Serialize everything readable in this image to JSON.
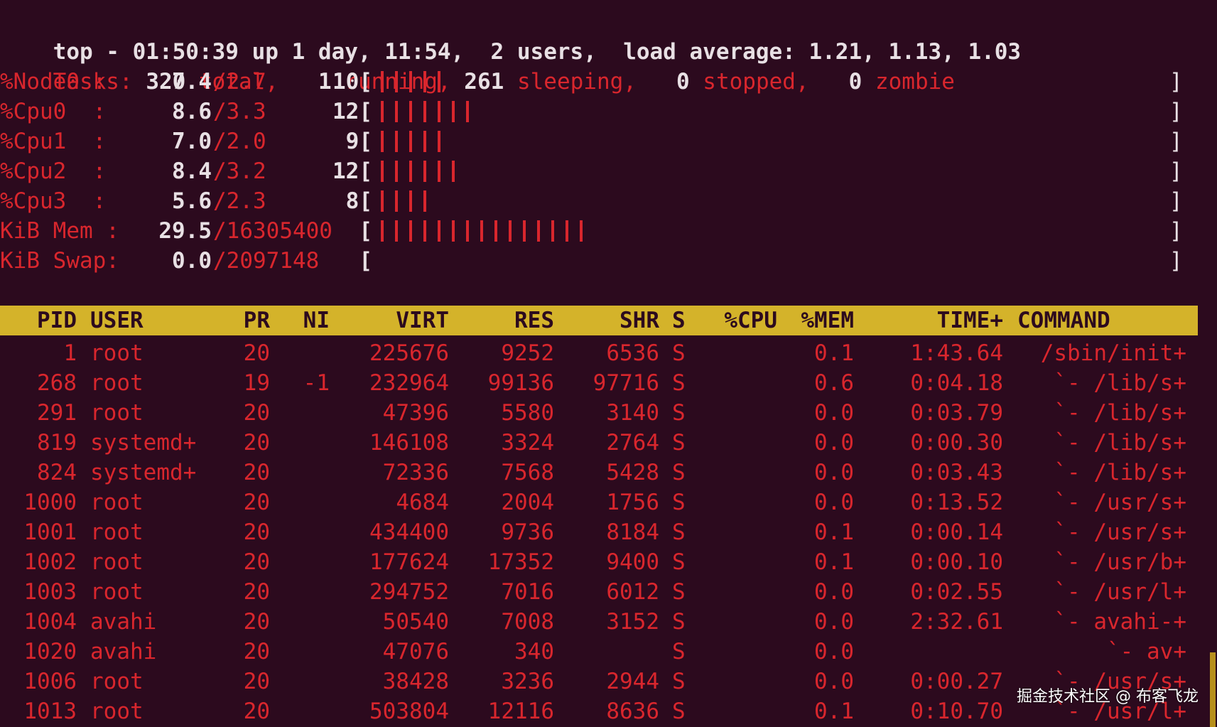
{
  "summary": {
    "line1": "top - 01:50:39 up 1 day, 11:54,  2 users,  load average: 1.21, 1.13, 1.03",
    "tasks": {
      "label": "Tasks:",
      "total": "320",
      "total_label": "total,",
      "running": "1",
      "running_label": "running,",
      "sleeping": "261",
      "sleeping_label": "sleeping,",
      "stopped": "0",
      "stopped_label": "stopped,",
      "zombie": "0",
      "zombie_label": "zombie"
    },
    "meters": [
      {
        "label": "%Node0 :",
        "v1": "7.4",
        "v2": "/2.7",
        "v3": "10[",
        "ticks": 5
      },
      {
        "label": "%Cpu0  :",
        "v1": "8.6",
        "v2": "/3.3",
        "v3": "12[",
        "ticks": 7
      },
      {
        "label": "%Cpu1  :",
        "v1": "7.0",
        "v2": "/2.0",
        "v3": "9[",
        "ticks": 5
      },
      {
        "label": "%Cpu2  :",
        "v1": "8.4",
        "v2": "/3.2",
        "v3": "12[",
        "ticks": 6
      },
      {
        "label": "%Cpu3  :",
        "v1": "5.6",
        "v2": "/2.3",
        "v3": "8[",
        "ticks": 4
      },
      {
        "label": "KiB Mem :",
        "v1": "29.5",
        "v2": "/16305400",
        "v3": "[",
        "ticks": 15
      },
      {
        "label": "KiB Swap:",
        "v1": "0.0",
        "v2": "/2097148",
        "v3": "[",
        "ticks": 0
      }
    ],
    "bar_close": "]"
  },
  "table": {
    "headers": {
      "pid": "PID",
      "user": "USER",
      "pr": "PR",
      "ni": "NI",
      "virt": "VIRT",
      "res": "RES",
      "shr": "SHR",
      "s": "S",
      "cpu": "%CPU",
      "mem": "%MEM",
      "time": "TIME+",
      "command": "COMMAND"
    },
    "rows": [
      {
        "pid": "1",
        "user": "root",
        "pr": "20",
        "ni": "",
        "virt": "225676",
        "res": "9252",
        "shr": "6536",
        "s": "S",
        "cpu": "",
        "mem": "0.1",
        "time": "1:43.64",
        "command": "/sbin/init+"
      },
      {
        "pid": "268",
        "user": "root",
        "pr": "19",
        "ni": "-1",
        "virt": "232964",
        "res": "99136",
        "shr": "97716",
        "s": "S",
        "cpu": "",
        "mem": "0.6",
        "time": "0:04.18",
        "command": "`- /lib/s+"
      },
      {
        "pid": "291",
        "user": "root",
        "pr": "20",
        "ni": "",
        "virt": "47396",
        "res": "5580",
        "shr": "3140",
        "s": "S",
        "cpu": "",
        "mem": "0.0",
        "time": "0:03.79",
        "command": "`- /lib/s+"
      },
      {
        "pid": "819",
        "user": "systemd+",
        "pr": "20",
        "ni": "",
        "virt": "146108",
        "res": "3324",
        "shr": "2764",
        "s": "S",
        "cpu": "",
        "mem": "0.0",
        "time": "0:00.30",
        "command": "`- /lib/s+"
      },
      {
        "pid": "824",
        "user": "systemd+",
        "pr": "20",
        "ni": "",
        "virt": "72336",
        "res": "7568",
        "shr": "5428",
        "s": "S",
        "cpu": "",
        "mem": "0.0",
        "time": "0:03.43",
        "command": "`- /lib/s+"
      },
      {
        "pid": "1000",
        "user": "root",
        "pr": "20",
        "ni": "",
        "virt": "4684",
        "res": "2004",
        "shr": "1756",
        "s": "S",
        "cpu": "",
        "mem": "0.0",
        "time": "0:13.52",
        "command": "`- /usr/s+"
      },
      {
        "pid": "1001",
        "user": "root",
        "pr": "20",
        "ni": "",
        "virt": "434400",
        "res": "9736",
        "shr": "8184",
        "s": "S",
        "cpu": "",
        "mem": "0.1",
        "time": "0:00.14",
        "command": "`- /usr/s+"
      },
      {
        "pid": "1002",
        "user": "root",
        "pr": "20",
        "ni": "",
        "virt": "177624",
        "res": "17352",
        "shr": "9400",
        "s": "S",
        "cpu": "",
        "mem": "0.1",
        "time": "0:00.10",
        "command": "`- /usr/b+"
      },
      {
        "pid": "1003",
        "user": "root",
        "pr": "20",
        "ni": "",
        "virt": "294752",
        "res": "7016",
        "shr": "6012",
        "s": "S",
        "cpu": "",
        "mem": "0.0",
        "time": "0:02.55",
        "command": "`- /usr/l+"
      },
      {
        "pid": "1004",
        "user": "avahi",
        "pr": "20",
        "ni": "",
        "virt": "50540",
        "res": "7008",
        "shr": "3152",
        "s": "S",
        "cpu": "",
        "mem": "0.0",
        "time": "2:32.61",
        "command": "`- avahi-+"
      },
      {
        "pid": "1020",
        "user": "avahi",
        "pr": "20",
        "ni": "",
        "virt": "47076",
        "res": "340",
        "shr": "",
        "s": "S",
        "cpu": "",
        "mem": "0.0",
        "time": "",
        "command": "`- av+"
      },
      {
        "pid": "1006",
        "user": "root",
        "pr": "20",
        "ni": "",
        "virt": "38428",
        "res": "3236",
        "shr": "2944",
        "s": "S",
        "cpu": "",
        "mem": "0.0",
        "time": "0:00.27",
        "command": "`- /usr/s+"
      },
      {
        "pid": "1013",
        "user": "root",
        "pr": "20",
        "ni": "",
        "virt": "503804",
        "res": "12116",
        "shr": "8636",
        "s": "S",
        "cpu": "",
        "mem": "0.1",
        "time": "0:10.70",
        "command": "`- /usr/l+"
      }
    ]
  },
  "watermark": "掘金技术社区 @ 布客飞龙",
  "colors": {
    "background": "#2c0a1e",
    "text": "#e8e0e4",
    "accent_red": "#d9262d",
    "header_bar": "#d4b32a"
  }
}
